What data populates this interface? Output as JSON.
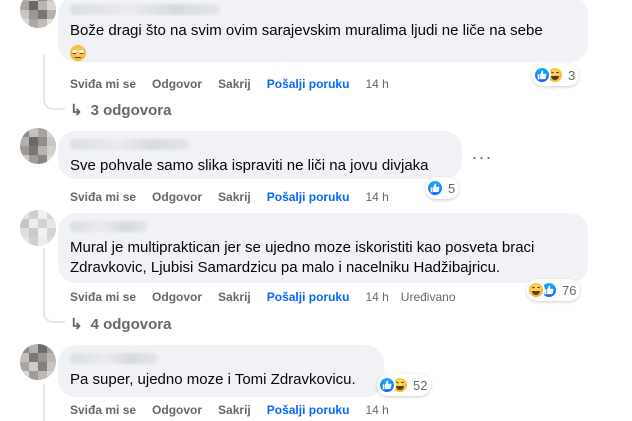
{
  "comments": [
    {
      "text": "Bože dragi što na svim ovim sarajevskim muralima ljudi ne liče na sebe",
      "emoji": "rolling-eyes-emoji",
      "reaction_count": "3",
      "reaction_icons": [
        "like",
        "haha"
      ],
      "time": "14 h",
      "replies": "3 odgovora"
    },
    {
      "text": "Sve pohvale samo slika ispraviti ne liči na jovu divjaka",
      "reaction_count": "5",
      "reaction_icons": [
        "like"
      ],
      "time": "14 h",
      "more": "···"
    },
    {
      "text": "Mural je multipraktican jer se ujedno moze iskoristiti kao posveta braci\nZdravkovic, Ljubisi Samardzicu pa malo i nacelniku Hadžibajricu.",
      "reaction_count": "76",
      "reaction_icons": [
        "haha",
        "like"
      ],
      "time": "14 h",
      "edited": "Uređivano",
      "replies": "4 odgovora"
    },
    {
      "text": "Pa super, ujedno moze i Tomi Zdravkovicu.",
      "reaction_count": "52",
      "reaction_icons": [
        "like",
        "haha"
      ],
      "time": "14 h"
    }
  ],
  "actions": {
    "like": "Sviđa mi se",
    "reply": "Odgovor",
    "hide": "Sakrij",
    "send": "Pošalji poruku"
  },
  "colors": {
    "bubble": "#f0f2f5",
    "secondary_text": "#65676b",
    "accent": "#0866ff"
  }
}
